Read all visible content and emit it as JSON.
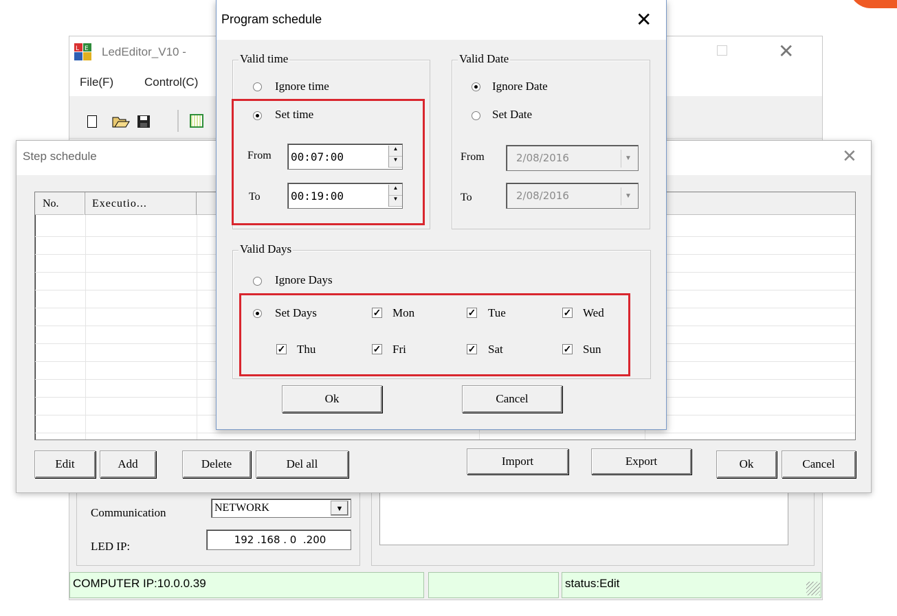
{
  "main_window": {
    "title": "LedEditor_V10 -",
    "menu": [
      "File(F)",
      "Control(C)"
    ],
    "communication_label": "Communication",
    "communication_value": "NETWORK",
    "led_ip_label": "LED IP:",
    "led_ip_value": "192 .168 . 0  .200",
    "status_bar": {
      "computer_ip": "COMPUTER IP:10.0.0.39",
      "status": "status:Edit"
    },
    "colors": {
      "status_bg": "#e6ffe6",
      "red_highlight": "#d9262e"
    }
  },
  "step_schedule": {
    "title": "Step schedule",
    "columns": [
      "No.",
      "Executio..."
    ],
    "buttons": {
      "edit": "Edit",
      "add": "Add",
      "delete": "Delete",
      "del_all": "Del all",
      "import": "Import",
      "export": "Export",
      "ok": "Ok",
      "cancel": "Cancel"
    }
  },
  "program_schedule": {
    "title": "Program schedule",
    "valid_time": {
      "title": "Valid time",
      "ignore_label": "Ignore time",
      "set_label": "Set time",
      "selected": "set",
      "from_label": "From",
      "from_value": "00:07:00",
      "to_label": "To",
      "to_value": "00:19:00"
    },
    "valid_date": {
      "title": "Valid Date",
      "ignore_label": "Ignore Date",
      "set_label": "Set Date",
      "selected": "ignore",
      "from_label": "From",
      "from_value": "2/08/2016",
      "to_label": "To",
      "to_value": "2/08/2016"
    },
    "valid_days": {
      "title": "Valid Days",
      "ignore_label": "Ignore Days",
      "set_label": "Set Days",
      "selected": "set",
      "days": [
        {
          "label": "Mon",
          "checked": true
        },
        {
          "label": "Tue",
          "checked": true
        },
        {
          "label": "Wed",
          "checked": true
        },
        {
          "label": "Thu",
          "checked": true
        },
        {
          "label": "Fri",
          "checked": true
        },
        {
          "label": "Sat",
          "checked": true
        },
        {
          "label": "Sun",
          "checked": true
        }
      ]
    },
    "ok_label": "Ok",
    "cancel_label": "Cancel"
  }
}
